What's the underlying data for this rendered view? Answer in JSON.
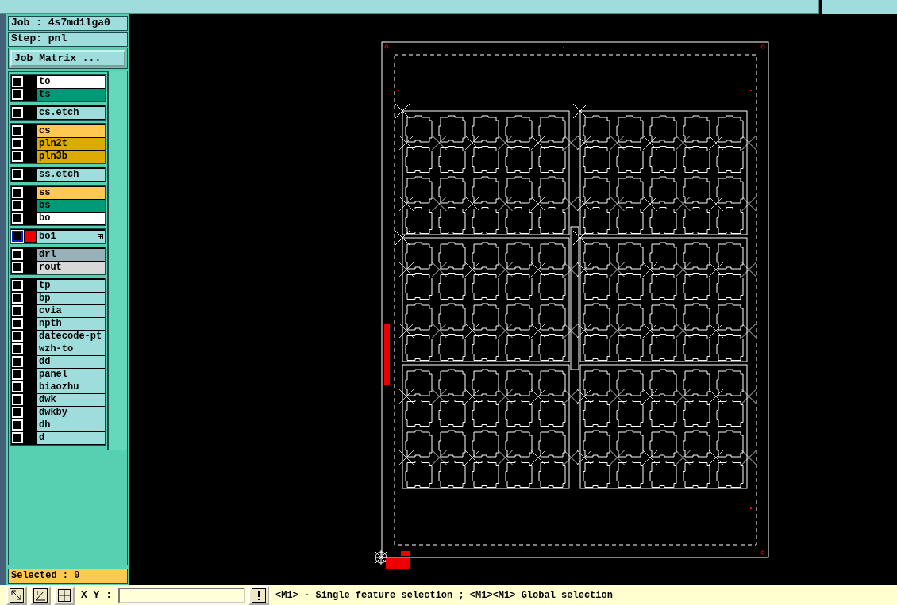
{
  "job_label": "Job : 4s7md1lga0",
  "step_label": "Step: pnl",
  "job_matrix_button": "Job Matrix ...",
  "layer_groups": [
    {
      "layers": [
        {
          "name": "to",
          "color": "#ffffff",
          "checked": false,
          "selected": false
        },
        {
          "name": "ts",
          "color": "#009a78",
          "checked": false,
          "selected": false
        }
      ]
    },
    {
      "layers": [
        {
          "name": "cs.etch",
          "color": "#9fdcdc",
          "checked": false,
          "selected": false
        }
      ]
    },
    {
      "layers": [
        {
          "name": "cs",
          "color": "#ffc850",
          "checked": false,
          "selected": false
        },
        {
          "name": "pln2t",
          "color": "#dcaa00",
          "checked": false,
          "selected": false
        },
        {
          "name": "pln3b",
          "color": "#dcaa00",
          "checked": false,
          "selected": false
        }
      ]
    },
    {
      "layers": [
        {
          "name": "ss.etch",
          "color": "#9fdcdc",
          "checked": false,
          "selected": false
        }
      ]
    },
    {
      "layers": [
        {
          "name": "ss",
          "color": "#ffc850",
          "checked": false,
          "selected": false
        },
        {
          "name": "bs",
          "color": "#009a78",
          "checked": false,
          "selected": false
        },
        {
          "name": "bo",
          "color": "#ffffff",
          "checked": false,
          "selected": false
        }
      ]
    },
    {
      "layers": [
        {
          "name": "bo1",
          "color": "#9fdcdc",
          "checked": false,
          "selected": true
        }
      ]
    },
    {
      "layers": [
        {
          "name": "drl",
          "color": "#98b0b8",
          "checked": false,
          "selected": false
        },
        {
          "name": "rout",
          "color": "#d8d8d8",
          "checked": false,
          "selected": false
        }
      ]
    },
    {
      "layers": [
        {
          "name": "tp",
          "color": "#9fdcdc",
          "checked": false,
          "selected": false
        },
        {
          "name": "bp",
          "color": "#9fdcdc",
          "checked": false,
          "selected": false
        },
        {
          "name": "cvia",
          "color": "#9fdcdc",
          "checked": false,
          "selected": false
        },
        {
          "name": "npth",
          "color": "#9fdcdc",
          "checked": false,
          "selected": false
        },
        {
          "name": "datecode-pt",
          "color": "#9fdcdc",
          "checked": false,
          "selected": false
        },
        {
          "name": "wzh-to",
          "color": "#9fdcdc",
          "checked": false,
          "selected": false
        },
        {
          "name": "dd",
          "color": "#9fdcdc",
          "checked": false,
          "selected": false
        },
        {
          "name": "panel",
          "color": "#9fdcdc",
          "checked": false,
          "selected": false
        },
        {
          "name": "biaozhu",
          "color": "#9fdcdc",
          "checked": false,
          "selected": false
        },
        {
          "name": "dwk",
          "color": "#9fdcdc",
          "checked": false,
          "selected": false
        },
        {
          "name": "dwkby",
          "color": "#9fdcdc",
          "checked": false,
          "selected": false
        },
        {
          "name": "dh",
          "color": "#9fdcdc",
          "checked": false,
          "selected": false
        },
        {
          "name": "d",
          "color": "#9fdcdc",
          "checked": false,
          "selected": false
        }
      ]
    }
  ],
  "selected_count": "Selected : 0",
  "bottom_bar": {
    "xy_label": "X Y :",
    "message": "<M1> - Single feature selection ; <M1><M1> Global selection"
  }
}
